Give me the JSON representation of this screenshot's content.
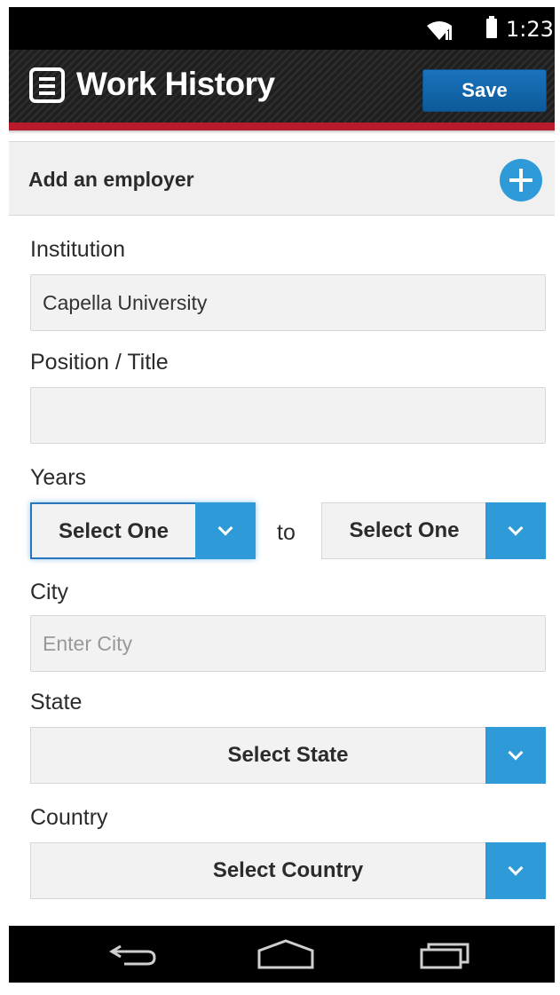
{
  "status_bar": {
    "time": "1:23"
  },
  "header": {
    "title": "Work History",
    "save_label": "Save",
    "accent_color": "#b81c2c"
  },
  "add_employer": {
    "label": "Add an employer"
  },
  "form": {
    "institution": {
      "label": "Institution",
      "value": "Capella University"
    },
    "position": {
      "label": "Position / Title",
      "value": ""
    },
    "years": {
      "label": "Years",
      "from": "Select One",
      "separator": "to",
      "to": "Select One"
    },
    "city": {
      "label": "City",
      "placeholder": "Enter City"
    },
    "state": {
      "label": "State",
      "value": "Select State"
    },
    "country": {
      "label": "Country",
      "value": "Select Country"
    }
  },
  "nav": {
    "back_icon": "back-icon",
    "home_icon": "home-icon",
    "recents_icon": "recents-icon"
  },
  "colors": {
    "button_blue": "#2e9ad8",
    "save_blue": "#1a73bd"
  }
}
